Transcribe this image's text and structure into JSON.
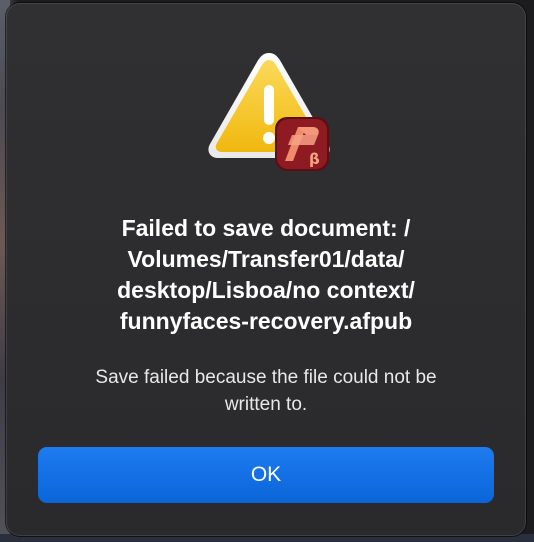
{
  "dialog": {
    "title": "Failed to save document: /Volumes/Transfer01/data/desktop/Lisboa/no context/funnyfaces-recovery.afpub",
    "title_lines": [
      "Failed to save document: /",
      "Volumes/Transfer01/data/",
      "desktop/Lisboa/no context/",
      "funnyfaces-recovery.afpub"
    ],
    "message_lines": [
      "Save failed because the file could not be",
      "written to."
    ],
    "ok_label": "OK",
    "icons": {
      "warning": "warning-triangle-icon",
      "app_badge": "affinity-publisher-beta-icon",
      "badge_letter": "β"
    }
  },
  "colors": {
    "dialog_bg": "#2c2c2e",
    "accent": "#0a6cdd",
    "warning_yellow": "#f5c518",
    "badge_red": "#8e1b22",
    "badge_orange": "#f08a6a"
  }
}
